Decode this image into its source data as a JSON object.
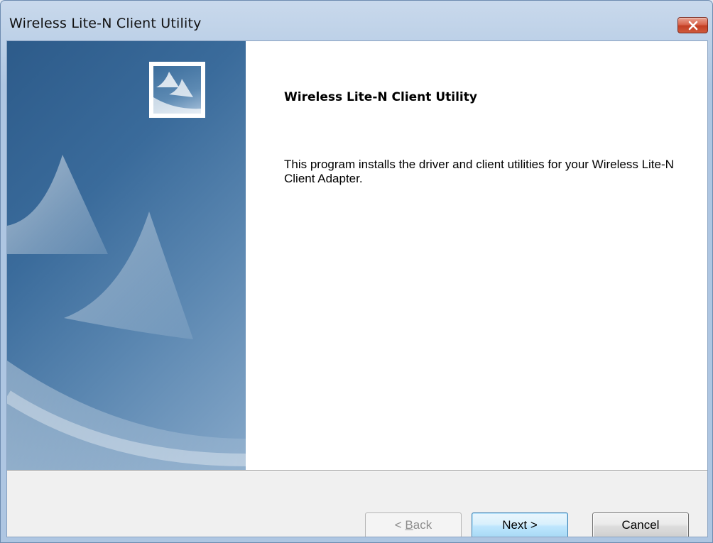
{
  "window": {
    "title": "Wireless Lite-N Client Utility",
    "close_icon": "close-icon"
  },
  "main": {
    "heading": "Wireless Lite-N Client Utility",
    "description": "This program installs the driver and client utilities for your Wireless Lite-N Client Adapter."
  },
  "buttons": {
    "back": {
      "prefix": "< ",
      "mnemonic": "B",
      "rest": "ack",
      "enabled": false
    },
    "next": {
      "label": "Next >",
      "default": true
    },
    "cancel": {
      "label": "Cancel"
    }
  },
  "colors": {
    "side_panel": "#3a6b9b",
    "close_button": "#c94a2f",
    "footer": "#f0f0f0"
  }
}
